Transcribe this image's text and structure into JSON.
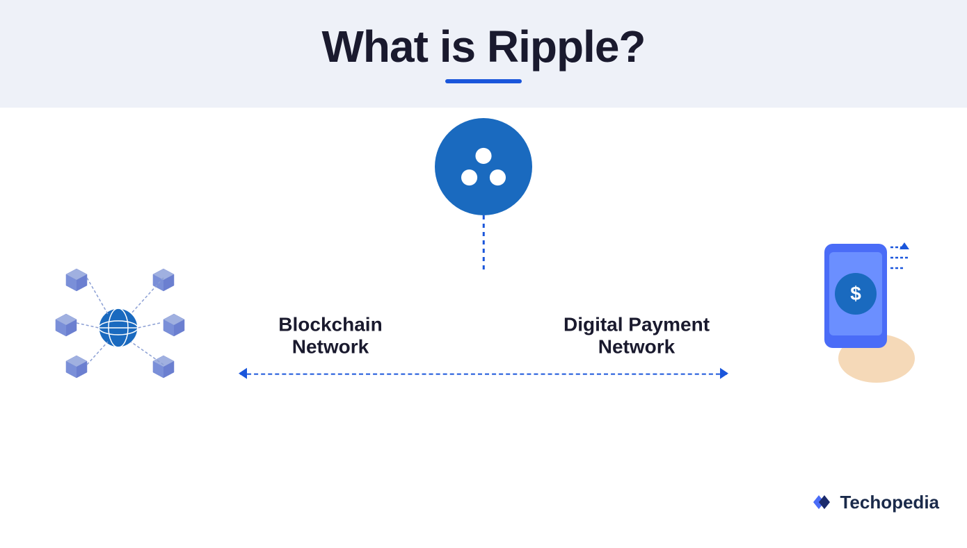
{
  "header": {
    "title": "What is Ripple?",
    "underline_color": "#1a56db"
  },
  "diagram": {
    "left_label_line1": "Blockchain",
    "left_label_line2": "Network",
    "right_label_line1": "Digital Payment",
    "right_label_line2": "Network"
  },
  "branding": {
    "name": "Techopedia"
  },
  "colors": {
    "background_header": "#eef1f8",
    "accent_blue": "#1a56db",
    "ripple_blue": "#1a6abf",
    "text_dark": "#1a1a2e"
  }
}
